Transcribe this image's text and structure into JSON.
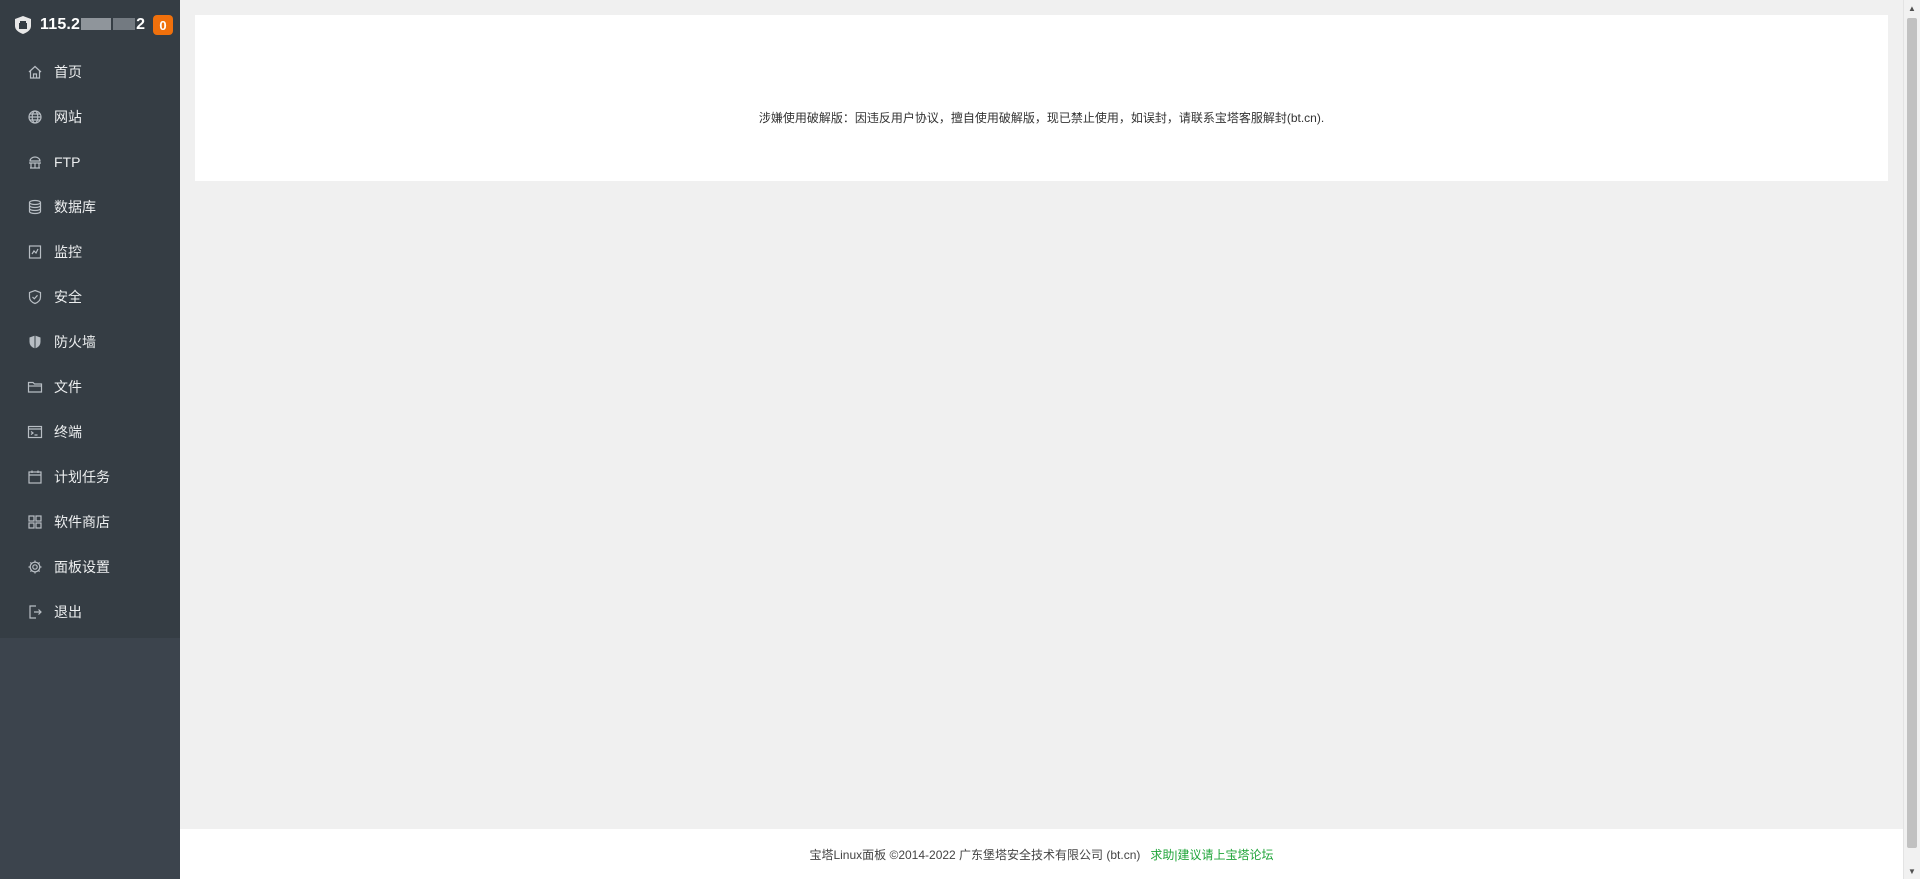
{
  "sidebar": {
    "server_ip_prefix": "115.2",
    "server_ip_suffix": "2",
    "badge_count": "0",
    "items": [
      {
        "label": "首页",
        "icon": "home-icon"
      },
      {
        "label": "网站",
        "icon": "globe-icon"
      },
      {
        "label": "FTP",
        "icon": "ftp-icon"
      },
      {
        "label": "数据库",
        "icon": "database-icon"
      },
      {
        "label": "监控",
        "icon": "monitor-icon"
      },
      {
        "label": "安全",
        "icon": "shield-icon"
      },
      {
        "label": "防火墙",
        "icon": "firewall-icon"
      },
      {
        "label": "文件",
        "icon": "folder-icon"
      },
      {
        "label": "终端",
        "icon": "terminal-icon"
      },
      {
        "label": "计划任务",
        "icon": "calendar-icon"
      },
      {
        "label": "软件商店",
        "icon": "apps-icon"
      },
      {
        "label": "面板设置",
        "icon": "gear-icon"
      },
      {
        "label": "退出",
        "icon": "logout-icon"
      }
    ]
  },
  "main": {
    "notice": "涉嫌使用破解版：因违反用户协议，擅自使用破解版，现已禁止使用，如误封，请联系宝塔客服解封(bt.cn)."
  },
  "footer": {
    "copyright": "宝塔Linux面板 ©2014-2022 广东堡塔安全技术有限公司 (bt.cn)",
    "forum_link": "求助|建议请上宝塔论坛"
  },
  "colors": {
    "sidebar_bg": "#3c444d",
    "menu_bg": "#353d44",
    "badge": "#f0700c",
    "accent_green": "#20a53a"
  }
}
